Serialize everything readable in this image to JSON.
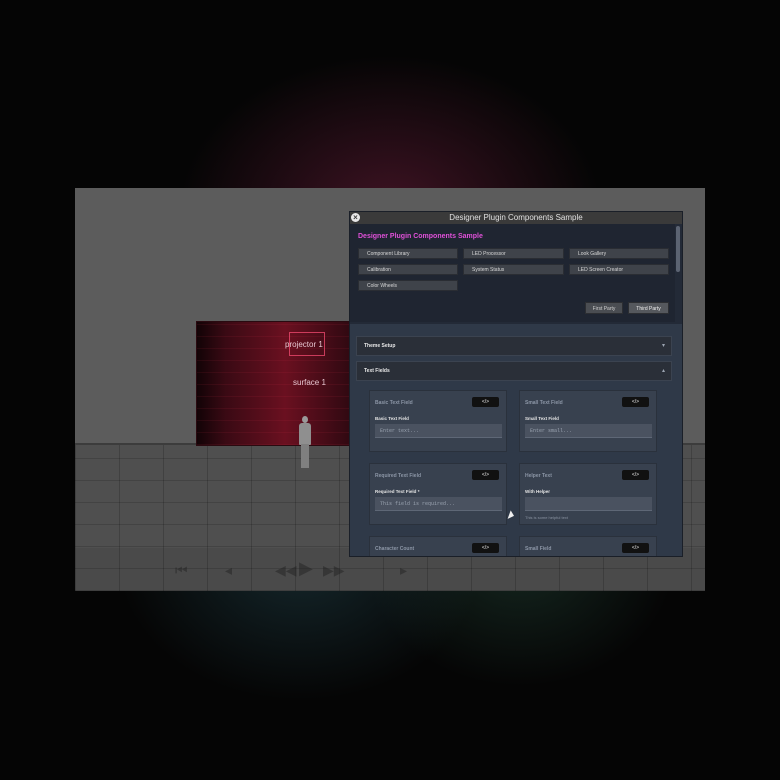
{
  "scene": {
    "projector_label": "projector 1",
    "surface_label": "surface 1"
  },
  "transport": {
    "icons": [
      "skip-back-icon",
      "step-back-icon",
      "rewind-icon",
      "play-icon",
      "fast-forward-icon",
      "step-forward-icon"
    ]
  },
  "dialog": {
    "title": "Designer Plugin Components Sample",
    "heading": "Designer Plugin Components Sample",
    "nav_buttons": [
      "Component Library",
      "LED Processor",
      "Look Gallery",
      "Calibration",
      "System Status",
      "LED Screen Creator",
      "Color Wheels"
    ],
    "party_buttons": [
      "First Party",
      "Third Party"
    ],
    "sections": {
      "theme_setup": "Theme Setup",
      "text_fields": "Text Fields"
    },
    "cards": [
      {
        "title": "Basic Text Field",
        "code": "</>",
        "field_label": "Basic Text Field",
        "placeholder": "Enter text..."
      },
      {
        "title": "Small Text Field",
        "code": "</>",
        "field_label": "Small Text Field",
        "placeholder": "Enter small..."
      },
      {
        "title": "Required Text Field",
        "code": "</>",
        "field_label": "Required Text Field",
        "required_mark": "*",
        "placeholder": "This field is required..."
      },
      {
        "title": "Helper Text",
        "code": "</>",
        "field_label": "With Helper",
        "placeholder": "",
        "helper": "This is some helpful text"
      },
      {
        "title": "Character Count",
        "code": "</>"
      },
      {
        "title": "Small Field",
        "code": "</>"
      }
    ]
  },
  "colors": {
    "heading_accent": "#e050d8",
    "dialog_bg": "#232a37",
    "content_bg": "#2f3948"
  }
}
